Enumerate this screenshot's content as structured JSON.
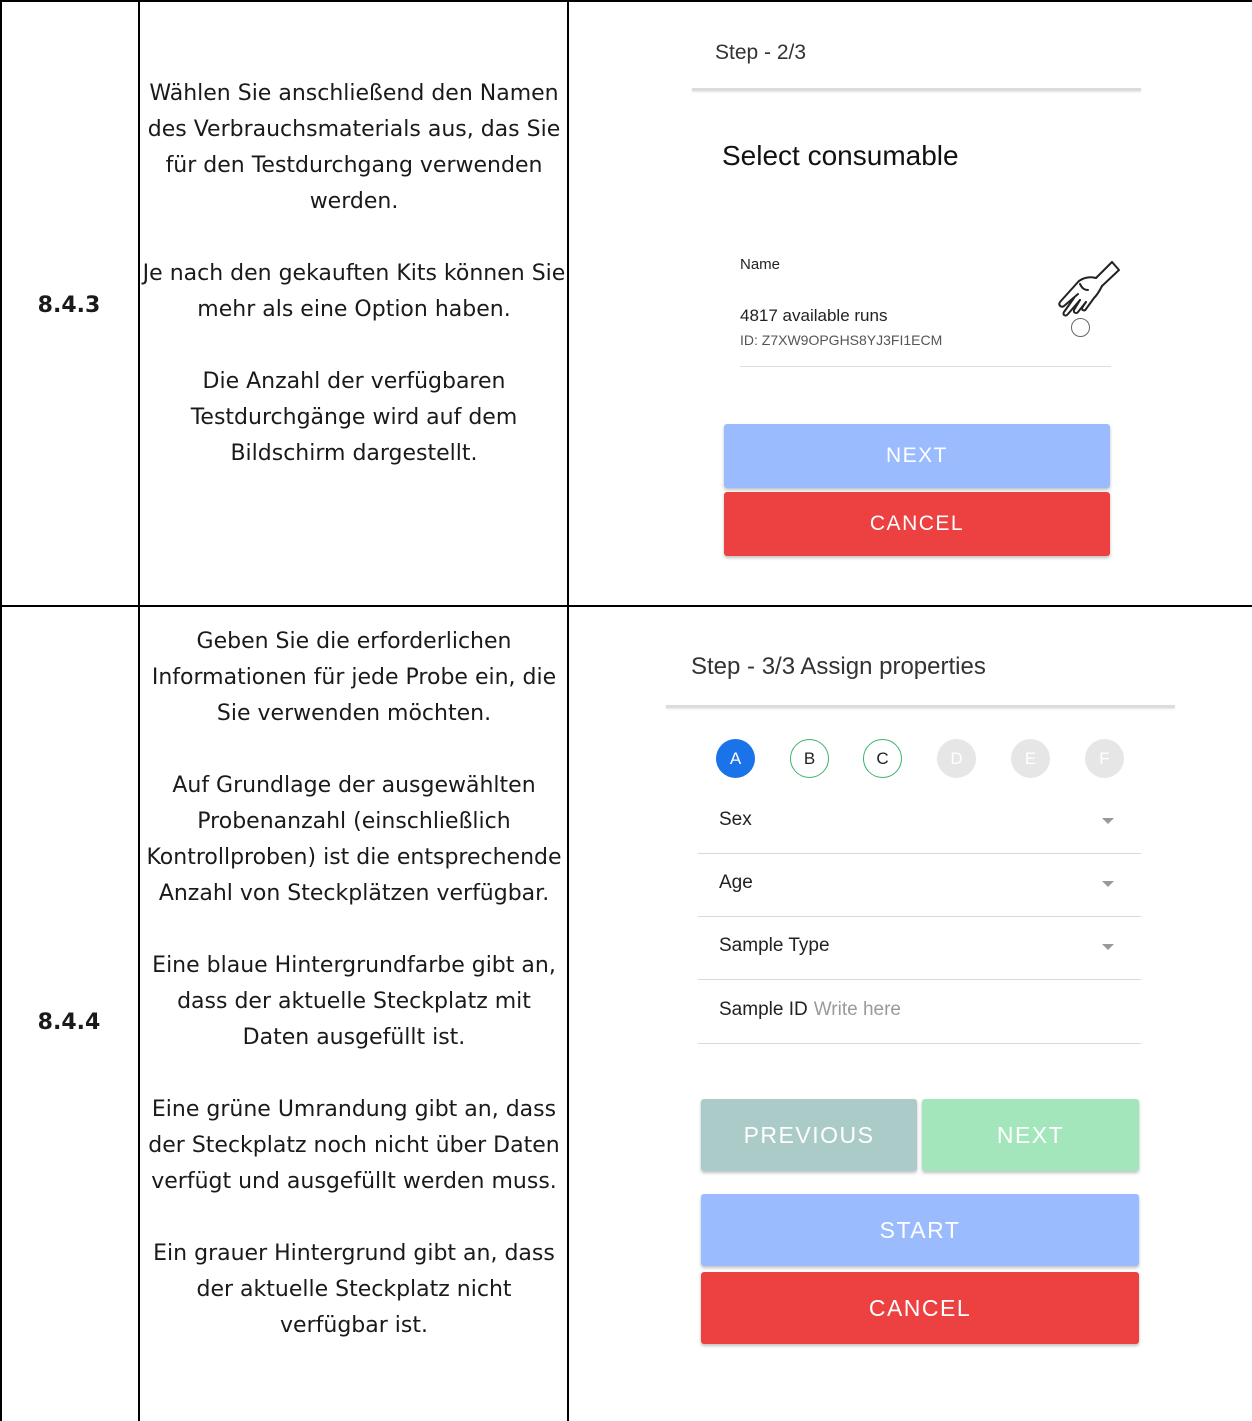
{
  "rows": [
    {
      "id": "8.4.3",
      "paragraphs": [
        "Wählen Sie anschließend den Namen des Verbrauchsmaterials aus, das Sie für den Testdurchgang verwenden werden.",
        "Je nach den gekauften Kits können Sie mehr als eine Option haben.",
        "Die Anzahl der verfügbaren Testdurchgänge wird auf dem Bildschirm dargestellt."
      ],
      "screen": {
        "step": "Step - 2/3",
        "title": "Select consumable",
        "name_label": "Name",
        "runs": "4817 available runs",
        "consumable_id": "ID: Z7XW9OPGHS8YJ3FI1ECM",
        "next_label": "NEXT",
        "cancel_label": "CANCEL"
      }
    },
    {
      "id": "8.4.4",
      "paragraphs": [
        "Geben Sie die erforderlichen Informationen für jede Probe ein, die Sie verwenden möchten.",
        "Auf Grundlage der ausgewählten Probenanzahl (einschließlich Kontrollproben) ist die entsprechende Anzahl von Steckplätzen verfügbar.",
        "Eine blaue Hintergrundfarbe gibt an, dass der aktuelle Steckplatz mit Daten ausgefüllt ist.",
        "Eine grüne Umrandung gibt an, dass der Steckplatz noch nicht über Daten verfügt und ausgefüllt werden muss.",
        "Ein grauer Hintergrund gibt an, dass der aktuelle Steckplatz nicht verfügbar ist."
      ],
      "screen": {
        "step": "Step - 3/3 Assign properties",
        "slots": [
          {
            "label": "A",
            "state": "filled"
          },
          {
            "label": "B",
            "state": "needs-data"
          },
          {
            "label": "C",
            "state": "needs-data"
          },
          {
            "label": "D",
            "state": "unavailable"
          },
          {
            "label": "E",
            "state": "unavailable"
          },
          {
            "label": "F",
            "state": "unavailable"
          }
        ],
        "fields": {
          "sex": "Sex",
          "age": "Age",
          "sample_type": "Sample Type",
          "sample_id": "Sample ID",
          "sample_id_placeholder": "Write here"
        },
        "previous_label": "PREVIOUS",
        "next_label": "NEXT",
        "start_label": "START",
        "cancel_label": "CANCEL"
      }
    }
  ],
  "colors": {
    "slot_filled": "#1a73e8",
    "slot_needs_data_border": "#3bb36b",
    "slot_unavailable": "#e6e6e6",
    "button_blue": "#9abcff",
    "button_red": "#ed4141",
    "button_teal": "#abcbc9",
    "button_green": "#a3e6bc"
  },
  "icons": [
    "pointing-hand-icon",
    "radio-button-icon",
    "dropdown-caret-icon"
  ]
}
